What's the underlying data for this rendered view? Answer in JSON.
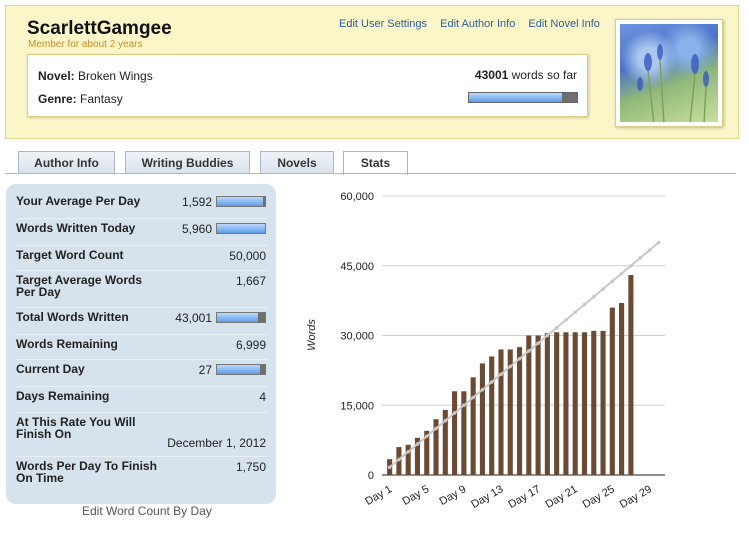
{
  "header": {
    "username": "ScarlettGamgee",
    "member_since": "Member for about 2 years",
    "links": [
      "Edit User Settings",
      "Edit Author Info",
      "Edit Novel Info"
    ],
    "novel_label": "Novel:",
    "novel_title": "Broken Wings",
    "genre_label": "Genre:",
    "genre": "Fantasy",
    "word_count": "43001",
    "words_suffix": "words so far",
    "progress_fraction": 0.86
  },
  "tabs": [
    {
      "label": "Author Info",
      "active": false
    },
    {
      "label": "Writing Buddies",
      "active": false
    },
    {
      "label": "Novels",
      "active": false
    },
    {
      "label": "Stats",
      "active": true
    }
  ],
  "stats": [
    {
      "label": "Your Average Per Day",
      "value": "1,592",
      "bar": 0.95
    },
    {
      "label": "Words Written Today",
      "value": "5,960",
      "bar": 1.0
    },
    {
      "label": "Target Word Count",
      "value": "50,000"
    },
    {
      "label": "Target Average Words Per Day",
      "value": "1,667"
    },
    {
      "label": "Total Words Written",
      "value": "43,001",
      "bar": 0.86
    },
    {
      "label": "Words Remaining",
      "value": "6,999"
    },
    {
      "label": "Current Day",
      "value": "27",
      "bar": 0.9
    },
    {
      "label": "Days Remaining",
      "value": "4"
    },
    {
      "label": "At This Rate You Will Finish On",
      "value": "December 1, 2012"
    },
    {
      "label": "Words Per Day To Finish On Time",
      "value": "1,750"
    }
  ],
  "edit_link": "Edit Word Count By Day",
  "colors": {
    "bar": "#6b4a34",
    "target_line": "#c8c8c8",
    "progress_fill": "#5d9ce8"
  },
  "chart_data": {
    "type": "bar",
    "ylabel": "Words",
    "xlabel": "",
    "ylim": [
      0,
      60000
    ],
    "yticks": [
      "0",
      "15,000",
      "30,000",
      "45,000",
      "60,000"
    ],
    "ytick_values": [
      0,
      15000,
      30000,
      45000,
      60000
    ],
    "xtick_labels": [
      "Day 1",
      "Day 5",
      "Day 9",
      "Day 13",
      "Day 17",
      "Day 21",
      "Day 25",
      "Day 29"
    ],
    "xtick_days": [
      1,
      5,
      9,
      13,
      17,
      21,
      25,
      29
    ],
    "days": [
      1,
      2,
      3,
      4,
      5,
      6,
      7,
      8,
      9,
      10,
      11,
      12,
      13,
      14,
      15,
      16,
      17,
      18,
      19,
      20,
      21,
      22,
      23,
      24,
      25,
      26,
      27
    ],
    "values": [
      3400,
      6000,
      6500,
      8000,
      9500,
      12000,
      14000,
      18000,
      18000,
      21000,
      24000,
      25500,
      27000,
      27000,
      27500,
      30000,
      30000,
      30500,
      30700,
      30700,
      30700,
      30700,
      31000,
      31000,
      36000,
      37000,
      43000
    ],
    "target": {
      "name": "",
      "from_day": 1,
      "to_day": 30,
      "from_value": 1667,
      "to_value": 50000
    },
    "grid": true,
    "legend": "none"
  }
}
